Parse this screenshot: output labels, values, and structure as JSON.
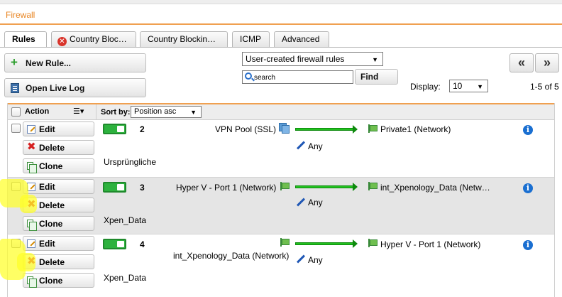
{
  "window": {
    "title": "Firewall"
  },
  "tabs": [
    {
      "label": "Rules",
      "active": true
    },
    {
      "label": "Country Bloc…",
      "icon": "error-icon"
    },
    {
      "label": "Country Blockin…"
    },
    {
      "label": "ICMP"
    },
    {
      "label": "Advanced"
    }
  ],
  "toolbar": {
    "new_rule_label": "New Rule...",
    "open_live_log_label": "Open Live Log",
    "filter_select_value": "User-created firewall rules",
    "search_placeholder": "search",
    "find_label": "Find",
    "display_label": "Display:",
    "display_value": "10",
    "range_text": "1-5 of 5",
    "first_page_glyph": "«",
    "next_page_glyph": "»"
  },
  "grid": {
    "action_header": "Action",
    "sort_by_label": "Sort by:",
    "sort_value": "Position asc",
    "action_buttons": {
      "edit": "Edit",
      "delete": "Delete",
      "clone": "Clone"
    },
    "rows": [
      {
        "position": "2",
        "source": "VPN Pool (SSL)",
        "source_icon": "server-icon",
        "service": "Any",
        "destination": "Private1 (Network)",
        "comment": "Ursprüngliche",
        "highlighted": false
      },
      {
        "position": "3",
        "source": "Hyper V - Port 1 (Network)",
        "source_icon": "network-icon",
        "service": "Any",
        "destination": "int_Xpenology_Data (Netw…",
        "comment": "Xpen_Data",
        "highlighted": true
      },
      {
        "position": "4",
        "source": "int_Xpenology_Data (Network)",
        "source_icon": "network-icon",
        "service": "Any",
        "destination": "Hyper V - Port 1 (Network)",
        "comment": "Xpen_Data",
        "highlighted": true
      }
    ]
  },
  "colors": {
    "accent_orange": "#e8831f",
    "toggle_green": "#2db23e",
    "arrow_green": "#22c11f",
    "highlighter_yellow": "#ffff28"
  }
}
